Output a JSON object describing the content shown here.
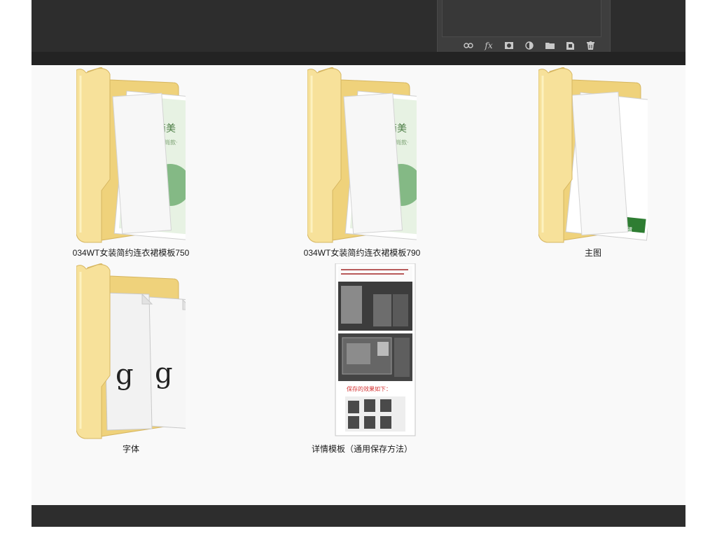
{
  "app": {
    "layers_toolbar": [
      "link-icon",
      "fx-icon",
      "mask-icon",
      "adjustment-icon",
      "folder-icon",
      "new-layer-icon",
      "trash-icon"
    ],
    "fx_label": "fx"
  },
  "folders": [
    {
      "label": "034WT女装简约连衣裙模板750",
      "kind": "folder-psd",
      "thumb_title": "简美",
      "thumb_sub": "时尚款·"
    },
    {
      "label": "034WT女装简约连衣裙模板790",
      "kind": "folder-psd",
      "thumb_title": "简美",
      "thumb_sub": "时尚款·"
    },
    {
      "label": "主图",
      "kind": "folder-main",
      "thumb_badge": "色均可编辑"
    },
    {
      "label": "字体",
      "kind": "folder-font",
      "glyph": "g"
    },
    {
      "label": "详情模板（通用保存方法）",
      "kind": "image-file",
      "thumb_heading": "保存的效果如下："
    }
  ],
  "colors": {
    "folder_back": "#f3d98a",
    "folder_front": "#f7e19a",
    "accent_green": "#2e7d32",
    "ps_dark": "#2d2d2d"
  }
}
